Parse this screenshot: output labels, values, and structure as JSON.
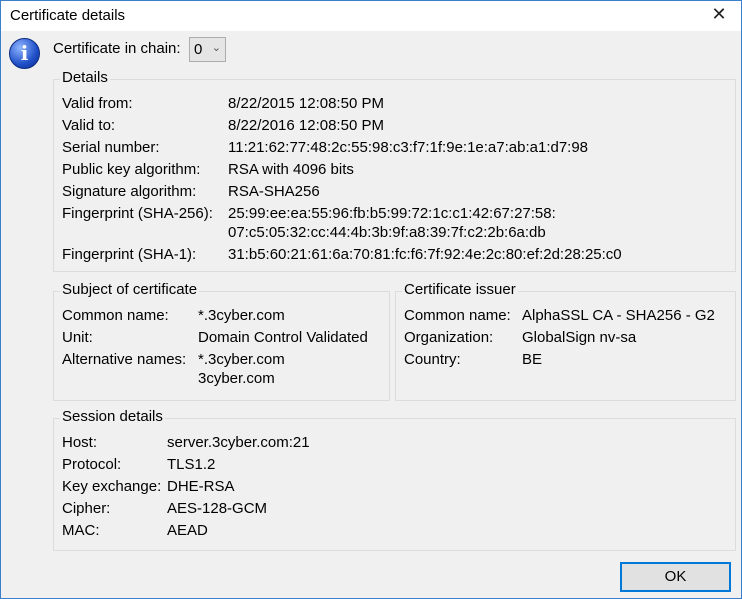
{
  "window": {
    "title": "Certificate details",
    "close": "✕"
  },
  "chain": {
    "label": "Certificate in chain:",
    "value": "0"
  },
  "details": {
    "legend": "Details",
    "rows": [
      [
        "Valid from:",
        "8/22/2015 12:08:50 PM"
      ],
      [
        "Valid to:",
        "8/22/2016 12:08:50 PM"
      ],
      [
        "Serial number:",
        "11:21:62:77:48:2c:55:98:c3:f7:1f:9e:1e:a7:ab:a1:d7:98"
      ],
      [
        "Public key algorithm:",
        "RSA with 4096 bits"
      ],
      [
        "Signature algorithm:",
        "RSA-SHA256"
      ],
      [
        "Fingerprint (SHA-256):",
        "25:99:ee:ea:55:96:fb:b5:99:72:1c:c1:42:67:27:58:"
      ],
      [
        "",
        "07:c5:05:32:cc:44:4b:3b:9f:a8:39:7f:c2:2b:6a:db"
      ],
      [
        "Fingerprint (SHA-1):",
        "31:b5:60:21:61:6a:70:81:fc:f6:7f:92:4e:2c:80:ef:2d:28:25:c0"
      ]
    ]
  },
  "subject": {
    "legend": "Subject of certificate",
    "rows": [
      [
        "Common name:",
        "*.3cyber.com"
      ],
      [
        "Unit:",
        "Domain Control Validated"
      ],
      [
        "Alternative names:",
        "*.3cyber.com"
      ],
      [
        "",
        "3cyber.com"
      ]
    ]
  },
  "issuer": {
    "legend": "Certificate issuer",
    "rows": [
      [
        "Common name:",
        "AlphaSSL CA - SHA256 - G2"
      ],
      [
        "Organization:",
        "GlobalSign nv-sa"
      ],
      [
        "Country:",
        "BE"
      ]
    ]
  },
  "session": {
    "legend": "Session details",
    "rows": [
      [
        "Host:",
        "server.3cyber.com:21"
      ],
      [
        "Protocol:",
        "TLS1.2"
      ],
      [
        "Key exchange:",
        "DHE-RSA"
      ],
      [
        "Cipher:",
        "AES-128-GCM"
      ],
      [
        "MAC:",
        "AEAD"
      ]
    ]
  },
  "ok_label": "OK"
}
